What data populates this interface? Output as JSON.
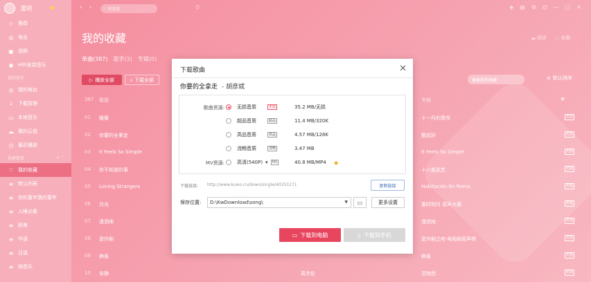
{
  "sidebar": {
    "username": "蕾玥",
    "vip_icon": "♥",
    "main_items": [
      {
        "icon": "star-icon",
        "glyph": "☆",
        "label": "推荐"
      },
      {
        "icon": "radio-icon",
        "glyph": "◎",
        "label": "电台"
      },
      {
        "icon": "video-icon",
        "glyph": "▣",
        "label": "视频"
      },
      {
        "icon": "hifi-icon",
        "glyph": "◉",
        "label": "HiFi发烧音乐"
      }
    ],
    "my_music_heading": "我的音乐",
    "my_items": [
      {
        "icon": "radio-icon",
        "glyph": "◎",
        "label": "我的电台"
      },
      {
        "icon": "download-icon",
        "glyph": "⤓",
        "label": "下载管理"
      },
      {
        "icon": "monitor-icon",
        "glyph": "▭",
        "label": "本地音乐"
      },
      {
        "icon": "cloud-icon",
        "glyph": "☁",
        "label": "我的云盘"
      },
      {
        "icon": "clock-icon",
        "glyph": "◷",
        "label": "最近播放"
      }
    ],
    "created_heading": "我建歌单",
    "playlists": [
      {
        "icon": "heart-icon",
        "glyph": "♡",
        "label": "我的收藏",
        "active": true
      },
      {
        "icon": "playlist-icon",
        "glyph": "≡",
        "label": "默认列表"
      },
      {
        "icon": "playlist-icon",
        "glyph": "≡",
        "label": "你的童年我的童年"
      },
      {
        "icon": "playlist-icon",
        "glyph": "≡",
        "label": "入睡必备"
      },
      {
        "icon": "playlist-icon",
        "glyph": "≡",
        "label": "欧美"
      },
      {
        "icon": "playlist-icon",
        "glyph": "≡",
        "label": "华语"
      },
      {
        "icon": "playlist-icon",
        "glyph": "≡",
        "label": "日语"
      },
      {
        "icon": "playlist-icon",
        "glyph": "≡",
        "label": "纯音乐"
      }
    ]
  },
  "topbar": {
    "search_placeholder": "搜索歌"
  },
  "main": {
    "title": "我的收藏",
    "sync_label": "同步",
    "backup_label": "存歌",
    "tabs": [
      {
        "label": "单曲(387)"
      },
      {
        "label": "歌手(3)"
      },
      {
        "label": "专辑(0)"
      }
    ],
    "play_all": "播放全部",
    "download_all": "下载全部",
    "search_placeholder": "搜索我的收藏",
    "sort_label": "默认排序",
    "columns": {
      "count": "387",
      "song": "歌曲",
      "album": "专辑"
    },
    "rows": [
      {
        "num": "01",
        "title": "暖暖",
        "album": "十一月的萧邦",
        "badge": "无损"
      },
      {
        "num": "02",
        "title": "你要的全拿走",
        "album": "鹦武好",
        "badge": "无损"
      },
      {
        "num": "03",
        "title": "It Feels So Simple",
        "album": "It Feels So Simple",
        "badge": "无损"
      },
      {
        "num": "04",
        "title": "你不知道的事",
        "album": "十八般武艺",
        "badge": "无损"
      },
      {
        "num": "05",
        "title": "Loving Strangers",
        "album": "Habitación En Roma",
        "badge": "无损"
      },
      {
        "num": "06",
        "title": "月光",
        "album": "童时明月 原声大碟",
        "badge": "无损"
      },
      {
        "num": "07",
        "title": "潇洒地",
        "album": "潇洒地",
        "badge": "无损"
      },
      {
        "num": "08",
        "title": "恶作剧",
        "album": "恶作剧之吻 电视剧原声带",
        "badge": "无损"
      },
      {
        "num": "09",
        "title": "麻雀",
        "album": "麻雀",
        "badge": "无损"
      },
      {
        "num": "10",
        "title": "安静",
        "artist": "周杰伦",
        "album": "范特西",
        "badge": "无损"
      }
    ]
  },
  "dialog": {
    "title": "下载歌曲",
    "close": "✕",
    "song": "你要的全拿走",
    "artist": "- 胡彦斌",
    "quality_label": "歌曲资源:",
    "mv_label": "MV资源:",
    "qualities": [
      {
        "name": "无损音质",
        "tag": "无损",
        "size": "35.2 MB/无损",
        "selected": true,
        "tag_red": true
      },
      {
        "name": "超品音质",
        "tag": "超品",
        "size": "11.4 MB/320K",
        "selected": false
      },
      {
        "name": "高品音质",
        "tag": "高品",
        "size": "4.57 MB/128K",
        "selected": false
      },
      {
        "name": "流畅音质",
        "tag": "流畅",
        "size": "3.47 MB",
        "selected": false
      }
    ],
    "mv": {
      "name": "高清(540P)",
      "dropdown": "▾",
      "tag": "MV",
      "size": "40.8 MB/MP4"
    },
    "link_label": "下载链接:",
    "link_value": "http://www.kuwo.cn/down/single/40351271",
    "copy_label": "复制链接",
    "path_label": "保存位置:",
    "path_value": "D:\\KwDownload\\song\\",
    "more_label": "更多设置",
    "download_pc": "下载到电脑",
    "download_phone": "下载到手机"
  },
  "colors": {
    "accent": "#e8455e",
    "sidebar": "#f7b0bb"
  }
}
